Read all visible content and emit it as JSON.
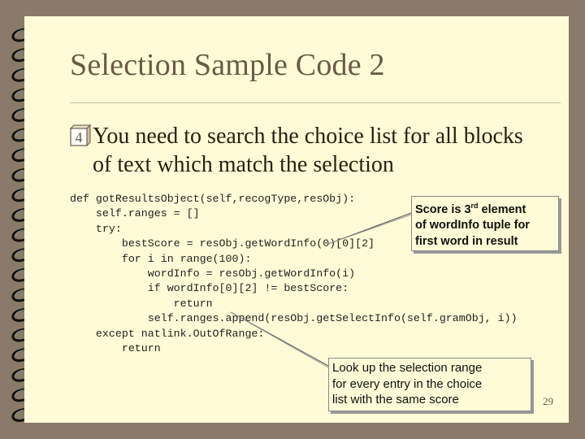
{
  "slide": {
    "title": "Selection Sample Code 2",
    "bullet": {
      "icon": "numbered-box-4-icon",
      "text": "You need to search the choice list for all blocks of text which match the selection"
    },
    "code": [
      "def gotResultsObject(self,recogType,resObj):",
      "    self.ranges = []",
      "    try:",
      "        bestScore = resObj.getWordInfo(0)[0][2]",
      "        for i in range(100):",
      "            wordInfo = resObj.getWordInfo(i)",
      "            if wordInfo[0][2] != bestScore:",
      "                return",
      "            self.ranges.append(resObj.getSelectInfo(self.gramObj, i))",
      "    except natlink.OutOfRange:",
      "        return"
    ],
    "callout_score": {
      "line1_prefix": "Score is 3",
      "line1_sup": "rd",
      "line1_suffix": " element",
      "line2": "of wordInfo tuple for",
      "line3": "first word in result"
    },
    "callout_lookup": {
      "line1": "Look up the selection range",
      "line2": "for every entry in the choice",
      "line3": "list with the same score"
    },
    "page_number": "29",
    "colors": {
      "background": "#8a7a6a",
      "slide": "#fffbd6",
      "title": "#6b5a45"
    }
  }
}
